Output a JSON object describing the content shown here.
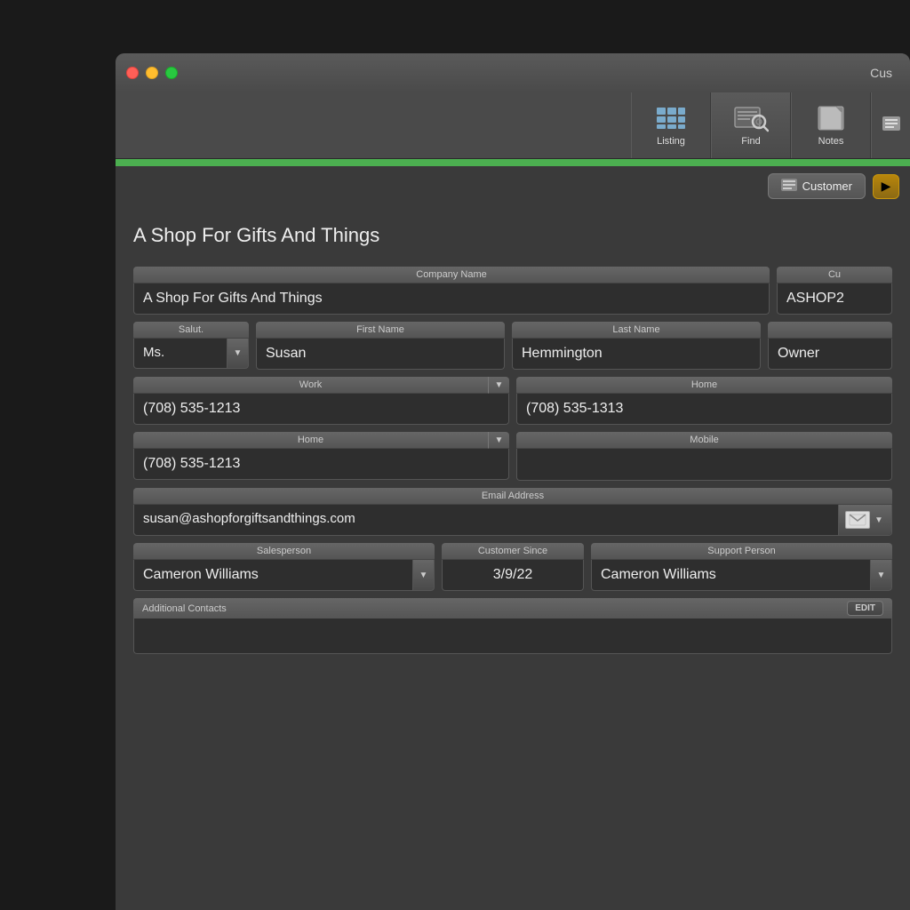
{
  "window": {
    "title": "Cus"
  },
  "toolbar": {
    "buttons": [
      {
        "id": "listing",
        "label": "Listing",
        "icon": "listing"
      },
      {
        "id": "find",
        "label": "Find",
        "icon": "find",
        "active": true
      },
      {
        "id": "notes",
        "label": "Notes",
        "icon": "notes"
      },
      {
        "id": "more",
        "label": "",
        "icon": "more"
      }
    ]
  },
  "segment": {
    "customer_label": "Customer",
    "customer_icon": "🗂️"
  },
  "record": {
    "title": "A Shop For Gifts And Things",
    "company_name_label": "Company Name",
    "company_name": "A Shop For Gifts And Things",
    "customer_code_label": "Cu",
    "customer_code": "ASHOP2",
    "salut_label": "Salut.",
    "salut_value": "Ms.",
    "first_name_label": "First Name",
    "first_name": "Susan",
    "last_name_label": "Last Name",
    "last_name": "Hemmington",
    "title_label": "",
    "title_value": "Owner",
    "work_label": "Work",
    "work_phone": "(708) 535-1213",
    "home_label_right": "Home",
    "home_phone_right": "(708) 535-1313",
    "home_label": "Home",
    "home_phone": "(708) 535-1213",
    "mobile_label": "Mobile",
    "mobile_phone": "",
    "email_label": "Email Address",
    "email": "susan@ashopforgiftsandthings.com",
    "salesperson_label": "Salesperson",
    "salesperson_value": "Cameron Williams",
    "customer_since_label": "Customer Since",
    "customer_since_value": "3/9/22",
    "support_person_label": "Support Person",
    "support_person_value": "Cameron Williams",
    "additional_contacts_label": "Additional Contacts",
    "edit_label": "EDIT"
  },
  "colors": {
    "green_bar": "#4caf50",
    "accent": "#555",
    "bg_dark": "#2e2e2e",
    "text_light": "#eee"
  }
}
